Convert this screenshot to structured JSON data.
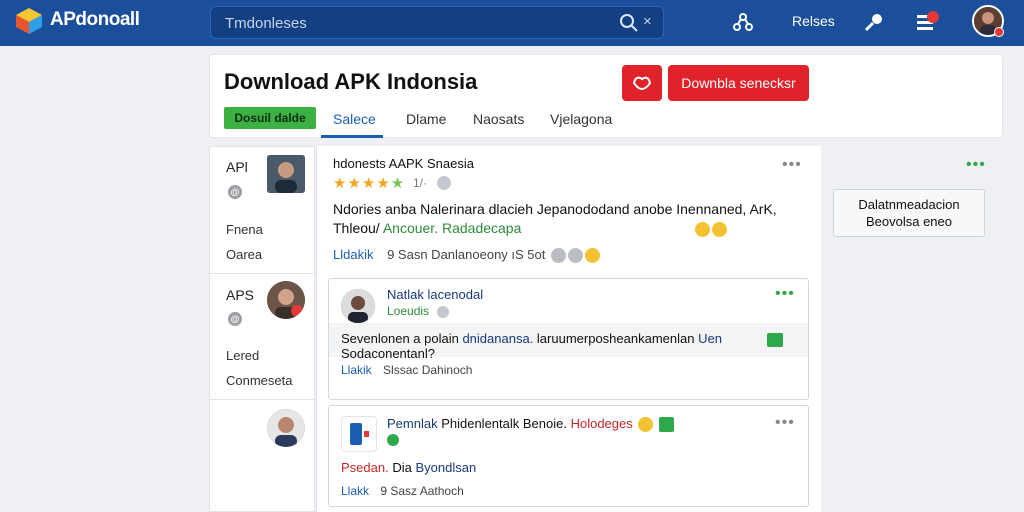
{
  "app": {
    "brand": "APdonoall"
  },
  "search": {
    "placeholder": "Tmdonleses",
    "clear": "×"
  },
  "topnav": {
    "label": "Relses"
  },
  "header": {
    "title": "Download APK Indonsia",
    "download_button": "Downbla senecksr",
    "green_button": "Dosuil dalde",
    "tabs": [
      {
        "label": "Salece",
        "active": true
      },
      {
        "label": "Dlame",
        "active": false
      },
      {
        "label": "Naosats",
        "active": false
      },
      {
        "label": "Vjelagona",
        "active": false
      }
    ]
  },
  "sidebar": {
    "section1": {
      "title": "APl",
      "item1": "Fnena",
      "item2": "Oarea"
    },
    "section2": {
      "title": "APS",
      "item1": "Lered",
      "item2": "Conmeseta"
    }
  },
  "post": {
    "title": "hdonests AAPK Snaesia",
    "rating": 4,
    "rating_max": 5,
    "rating_text": "1/·",
    "body_line1": "Ndories anba Nalerinara dlacieh Jepanododand anobe Inennaned, ArK,",
    "body_line2_prefix": "Thleou/",
    "body_line2_green": "Ancouer. Radadecapa",
    "action_link": "Lldakik",
    "action_text": "9 Sasn Danlanoeony ıS 5ot"
  },
  "comment1": {
    "name": "Natlak lacenodal",
    "sub": "Loeudis",
    "text_part1": "Sevenlonen a polain",
    "text_blue": "dnidanansa.",
    "text_part2": "laruumerposheankamenlan",
    "text_blue2": "Uen",
    "text_line2": "Sodaconentanl?",
    "action_link": "Llakik",
    "action_text": "Slssac Dahinoch"
  },
  "comment2": {
    "title_blue": "Pemnlak",
    "title_mid": "Phidenlentalk Benoie.",
    "title_red": "Holodeges",
    "text_red": "Psedan.",
    "text_mid": "Dia",
    "text_blue": "Byondlsan",
    "action_link": "Llakk",
    "action_text": "9 Sasz Aathoch"
  },
  "side_panel": {
    "line1": "Dalatnmeadacion",
    "line2": "Beovolsa eneo"
  },
  "colors": {
    "topbar": "#1b4f9c",
    "accent_red": "#e0232a",
    "accent_green": "#3cb043",
    "link_blue": "#1a5fb4",
    "star": "#f5a623"
  }
}
